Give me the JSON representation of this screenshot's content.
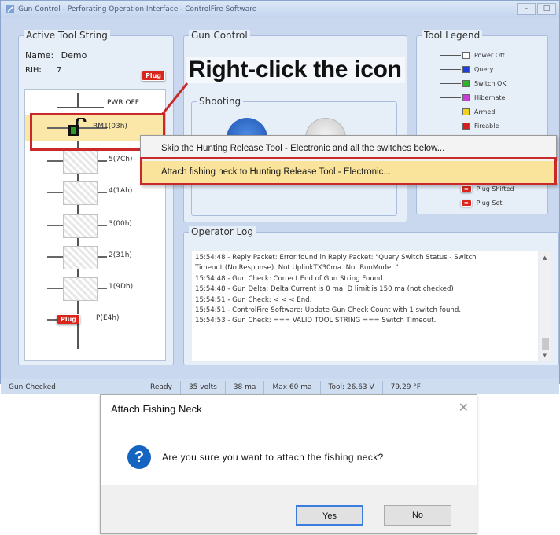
{
  "window": {
    "title": "Gun Control - Perforating Operation Interface - ControlFire Software"
  },
  "active_tool_string": {
    "legend": "Active Tool String",
    "name_label": "Name:",
    "name_value": "Demo",
    "rih_label": "RIH:",
    "rih_value": "7",
    "plug_badge": "Plug",
    "pwr_off": "PWR OFF",
    "tools": [
      {
        "label": "RM1(03h)"
      },
      {
        "label": "5(7Ch)"
      },
      {
        "label": "4(1Ah)"
      },
      {
        "label": "3(00h)"
      },
      {
        "label": "2(31h)"
      },
      {
        "label": "1(9Dh)"
      },
      {
        "label": "P(E4h)"
      }
    ],
    "bottom_plug_badge": "Plug"
  },
  "gun_control": {
    "legend": "Gun Control",
    "shooting_legend": "Shooting"
  },
  "callout": "Right-click the icon",
  "context_menu": {
    "items": [
      "Skip the Hunting Release Tool - Electronic and all the switches below...",
      "Attach fishing neck to Hunting Release Tool - Electronic..."
    ]
  },
  "tool_legend": {
    "legend": "Tool Legend",
    "items": [
      {
        "label": "Power Off",
        "color": "#ffffff"
      },
      {
        "label": "Query",
        "color": "#1f3fd6"
      },
      {
        "label": "Switch OK",
        "color": "#2bb32b"
      },
      {
        "label": "Hibernate",
        "color": "#c83fd8"
      },
      {
        "label": "Armed",
        "color": "#f0d020"
      },
      {
        "label": "Fireable",
        "color": "#d52020"
      }
    ],
    "plug_shifted": "Plug Shifted",
    "plug_set": "Plug Set"
  },
  "operator_log": {
    "legend": "Operator Log",
    "lines": [
      "15:54:48 - Reply Packet: Error found in Reply Packet: \"Query Switch Status - Switch",
      "Timeout (No Response). Not UplinkTX30ma. Not RunMode. \"",
      "15:54:48 - Gun Check: Correct End of Gun String Found.",
      "15:54:48 - Gun Delta: Delta Current is 0 ma. D limit is 150 ma (not checked)",
      "15:54:51 - Gun Check: < < < End.",
      "15:54:51 - ControlFire Software: Update Gun Check Count with 1 switch found.",
      "15:54:53 - Gun Check: === VALID TOOL STRING ===  Switch Timeout."
    ]
  },
  "status_bar": {
    "items": [
      "Gun Checked",
      "Ready",
      "35 volts",
      "38 ma",
      "Max 60 ma",
      "Tool: 26.63 V",
      "79.29 °F"
    ]
  },
  "dialog": {
    "title": "Attach Fishing Neck",
    "message": "Are you sure you want to attach the fishing neck?",
    "yes": "Yes",
    "no": "No",
    "close_glyph": "✕",
    "icon_glyph": "?"
  }
}
